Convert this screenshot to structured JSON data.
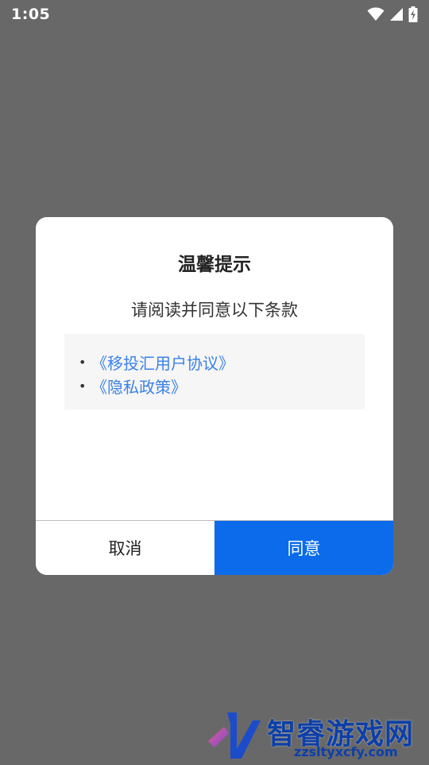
{
  "status_bar": {
    "time": "1:05",
    "icons": [
      "wifi-icon",
      "signal-icon",
      "battery-charging-icon"
    ]
  },
  "dialog": {
    "title": "温馨提示",
    "message": "请阅读并同意以下条款",
    "terms": [
      {
        "bullet": "•",
        "label": "《移投汇用户协议》"
      },
      {
        "bullet": "•",
        "label": "《隐私政策》"
      }
    ],
    "cancel_label": "取消",
    "agree_label": "同意"
  },
  "watermark": {
    "text": "智睿游戏网",
    "url": "zzsltyxcfy.com"
  },
  "colors": {
    "overlay": "#686868",
    "dialog_background": "#ffffff",
    "terms_background": "#f6f6f6",
    "link": "#3a82e6",
    "primary_button": "#0b6bea",
    "watermark": "#0d3fa8"
  }
}
